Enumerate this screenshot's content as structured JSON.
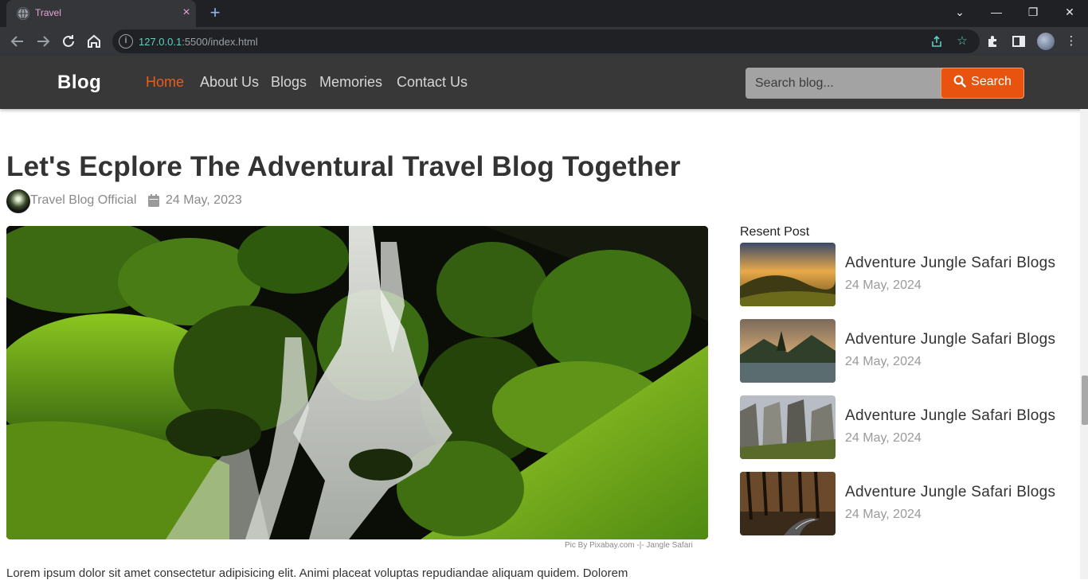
{
  "browser": {
    "tab_title": "Travel",
    "tab_close": "×",
    "new_tab": "+",
    "url_host": "127.0.0.1",
    "url_rest": ":5500/index.html",
    "controls": {
      "dropdown": "⌄",
      "minimize": "—",
      "restore": "❐",
      "close": "✕"
    }
  },
  "navbar": {
    "brand": "Blog",
    "links": [
      {
        "label": "Home",
        "active": true
      },
      {
        "label": "About Us",
        "active": false
      },
      {
        "label": "Blogs",
        "active": false
      },
      {
        "label": "Memories",
        "active": false
      },
      {
        "label": "Contact Us",
        "active": false
      }
    ],
    "search_placeholder": "Search blog...",
    "search_button": "Search"
  },
  "post": {
    "title": "Let's Ecplore The Adventural Travel Blog Together",
    "author": "Travel Blog Official",
    "date": "24 May, 2023",
    "image_caption": "Pic By Pixabay.com -|- Jangle Safari",
    "body": "Lorem ipsum dolor sit amet consectetur adipisicing elit. Animi placeat voluptas repudiandae aliquam quidem. Dolorem"
  },
  "sidebar": {
    "title": "Resent Post",
    "items": [
      {
        "title": "Adventure Jungle Safari Blogs",
        "date": "24 May, 2024"
      },
      {
        "title": "Adventure Jungle Safari Blogs",
        "date": "24 May, 2024"
      },
      {
        "title": "Adventure Jungle Safari Blogs",
        "date": "24 May, 2024"
      },
      {
        "title": "Adventure Jungle Safari Blogs",
        "date": "24 May, 2024"
      }
    ]
  },
  "colors": {
    "accent": "#e8530f",
    "navbar_bg": "#383838",
    "active_link": "#e85d1c"
  }
}
